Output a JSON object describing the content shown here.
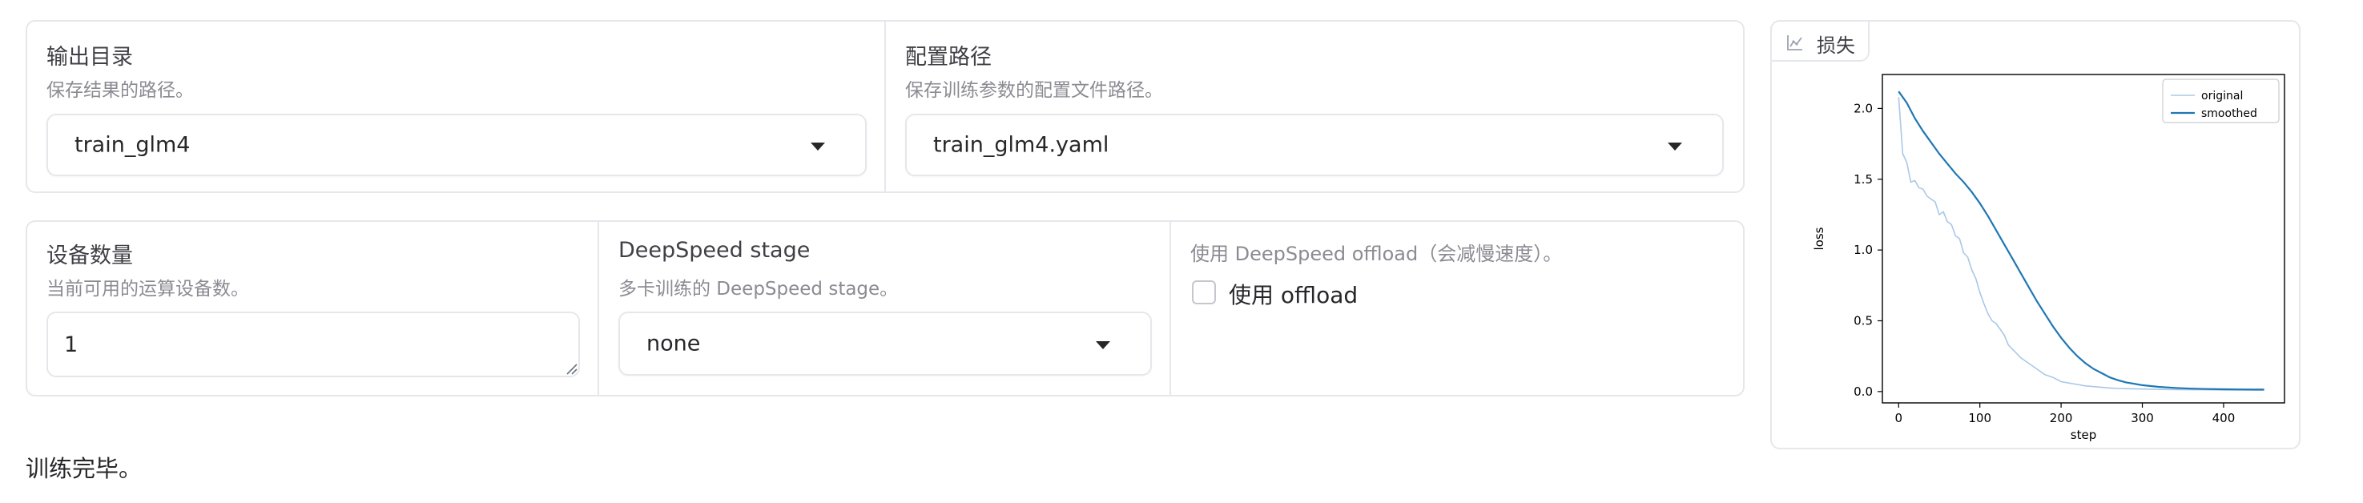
{
  "config_row": {
    "output_dir": {
      "label": "输出目录",
      "info": "保存结果的路径。",
      "value": "train_glm4"
    },
    "config_path": {
      "label": "配置路径",
      "info": "保存训练参数的配置文件路径。",
      "value": "train_glm4.yaml"
    }
  },
  "device_row": {
    "device_count": {
      "label": "设备数量",
      "info": "当前可用的运算设备数。",
      "value": "1"
    },
    "ds_stage": {
      "label": "DeepSpeed stage",
      "info": "多卡训练的 DeepSpeed stage。",
      "value": "none"
    },
    "ds_offload": {
      "info": "使用 DeepSpeed offload（会减慢速度）。",
      "checkbox_label": "使用 offload",
      "checked": false
    }
  },
  "status": {
    "message": "训练完毕。"
  },
  "loss_plot": {
    "tag_label": "损失",
    "tag_icon": "chart-icon"
  },
  "colors": {
    "border": "#e5e7eb",
    "original": "#aac8e6",
    "smoothed": "#1f77b4",
    "text": "#27272a",
    "info": "#8b8b93"
  },
  "chart_data": {
    "type": "line",
    "title": "",
    "xlabel": "step",
    "ylabel": "loss",
    "xlim": [
      -20,
      475
    ],
    "ylim": [
      -0.08,
      2.24
    ],
    "xticks": [
      0,
      100,
      200,
      300,
      400
    ],
    "yticks": [
      0.0,
      0.5,
      1.0,
      1.5,
      2.0
    ],
    "grid": false,
    "legend_position": "top-right",
    "series": [
      {
        "name": "original",
        "color": "#aac8e6",
        "x": [
          0,
          5,
          10,
          15,
          20,
          25,
          30,
          35,
          40,
          45,
          50,
          55,
          60,
          65,
          70,
          75,
          80,
          85,
          90,
          95,
          100,
          105,
          110,
          115,
          120,
          125,
          130,
          135,
          140,
          145,
          150,
          160,
          170,
          180,
          190,
          200,
          210,
          220,
          230,
          240,
          250,
          260,
          270,
          280,
          300,
          320,
          340,
          360,
          380,
          400,
          420,
          440,
          450
        ],
        "y": [
          2.08,
          1.68,
          1.62,
          1.48,
          1.49,
          1.44,
          1.43,
          1.38,
          1.36,
          1.34,
          1.25,
          1.27,
          1.2,
          1.18,
          1.1,
          1.08,
          0.98,
          0.95,
          0.86,
          0.8,
          0.7,
          0.62,
          0.55,
          0.5,
          0.48,
          0.44,
          0.4,
          0.33,
          0.3,
          0.27,
          0.24,
          0.2,
          0.16,
          0.12,
          0.1,
          0.07,
          0.06,
          0.05,
          0.04,
          0.035,
          0.03,
          0.025,
          0.022,
          0.02,
          0.018,
          0.015,
          0.014,
          0.013,
          0.012,
          0.011,
          0.01,
          0.01,
          0.01
        ]
      },
      {
        "name": "smoothed",
        "color": "#1f77b4",
        "x": [
          0,
          10,
          20,
          30,
          40,
          50,
          60,
          70,
          80,
          90,
          100,
          110,
          120,
          130,
          140,
          150,
          160,
          170,
          180,
          190,
          200,
          210,
          220,
          230,
          240,
          250,
          260,
          270,
          280,
          300,
          320,
          340,
          360,
          380,
          400,
          420,
          440,
          450
        ],
        "y": [
          2.12,
          2.04,
          1.93,
          1.84,
          1.76,
          1.68,
          1.61,
          1.54,
          1.48,
          1.41,
          1.33,
          1.24,
          1.14,
          1.04,
          0.94,
          0.84,
          0.74,
          0.64,
          0.55,
          0.46,
          0.38,
          0.31,
          0.25,
          0.2,
          0.16,
          0.13,
          0.1,
          0.08,
          0.065,
          0.045,
          0.033,
          0.026,
          0.021,
          0.018,
          0.016,
          0.015,
          0.014,
          0.014
        ]
      }
    ]
  }
}
